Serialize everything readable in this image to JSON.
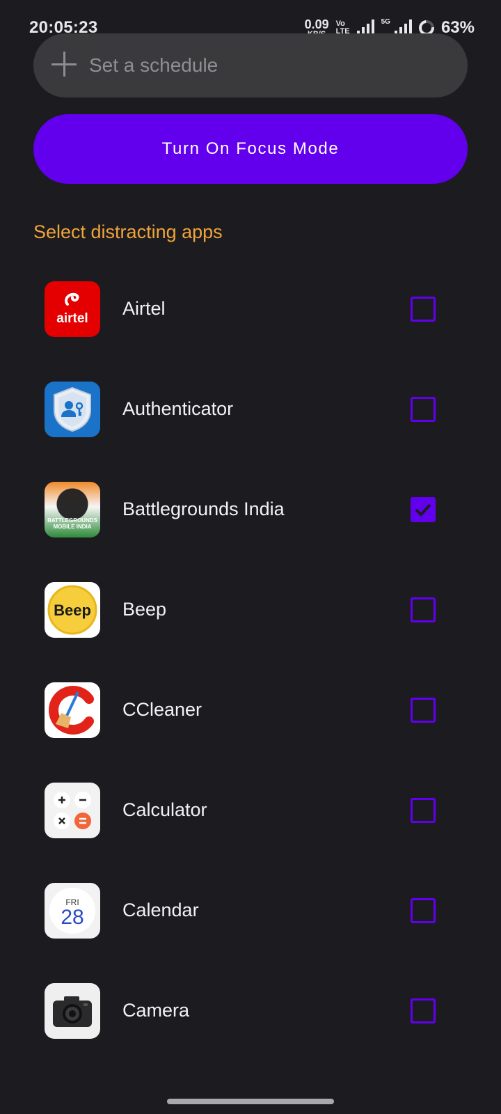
{
  "status_bar": {
    "time": "20:05:23",
    "net_speed_value": "0.09",
    "net_speed_unit": "KB/S",
    "volte_top": "Vo",
    "volte_bottom": "LTE",
    "five_g": "5G",
    "battery": "63%"
  },
  "schedule": {
    "label": "Set a schedule"
  },
  "focus_button": {
    "label": "Turn On Focus Mode"
  },
  "section_title": "Select distracting apps",
  "apps": [
    {
      "name": "Airtel",
      "checked": false,
      "icon": "airtel-icon"
    },
    {
      "name": "Authenticator",
      "checked": false,
      "icon": "authenticator-icon"
    },
    {
      "name": "Battlegrounds India",
      "checked": true,
      "icon": "battlegrounds-india-icon"
    },
    {
      "name": "Beep",
      "checked": false,
      "icon": "beep-icon"
    },
    {
      "name": "CCleaner",
      "checked": false,
      "icon": "ccleaner-icon"
    },
    {
      "name": "Calculator",
      "checked": false,
      "icon": "calculator-icon"
    },
    {
      "name": "Calendar",
      "checked": false,
      "icon": "calendar-icon"
    },
    {
      "name": "Camera",
      "checked": false,
      "icon": "camera-icon"
    }
  ],
  "icon_text": {
    "airtel": "airtel",
    "bgmi_line1": "BATTLEGROUNDS",
    "bgmi_line2": "MOBILE INDIA",
    "beep": "Beep",
    "calendar_day": "FRI",
    "calendar_date": "28"
  },
  "colors": {
    "background": "#1c1b20",
    "accent": "#6200ee",
    "section_title": "#f0a43a",
    "pill": "#3a3a3d"
  }
}
